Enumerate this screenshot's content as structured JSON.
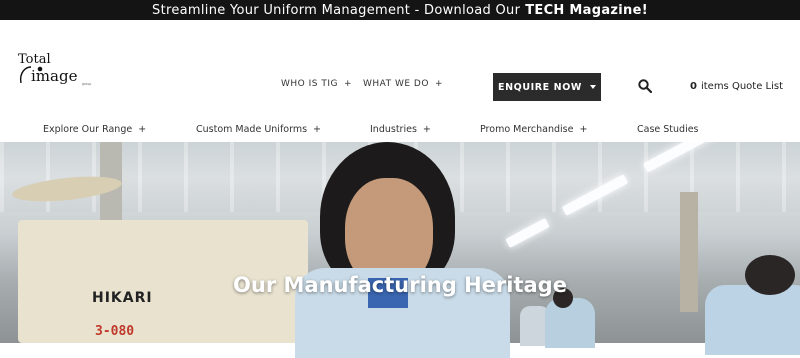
{
  "banner": {
    "text": "Streamline Your Uniform Management - Download Our",
    "highlight": "TECH Magazine!"
  },
  "logo": {
    "line1": "Total",
    "line2": "image",
    "sub": "group"
  },
  "nav_main": [
    {
      "label": "WHO IS TIG",
      "plus": "+"
    },
    {
      "label": "WHAT WE DO",
      "plus": "+"
    }
  ],
  "enquire": {
    "label": "ENQUIRE NOW"
  },
  "quote": {
    "count": "0",
    "label": "items Quote List"
  },
  "nav_secondary": [
    {
      "label": "Explore Our Range",
      "plus": "+"
    },
    {
      "label": "Custom Made Uniforms",
      "plus": "+"
    },
    {
      "label": "Industries",
      "plus": "+"
    },
    {
      "label": "Promo Merchandise",
      "plus": "+"
    },
    {
      "label": "Case Studies",
      "plus": ""
    }
  ],
  "hero": {
    "title": "Our Manufacturing Heritage",
    "machine_brand": "HIKARI",
    "machine_model": "3-080"
  }
}
